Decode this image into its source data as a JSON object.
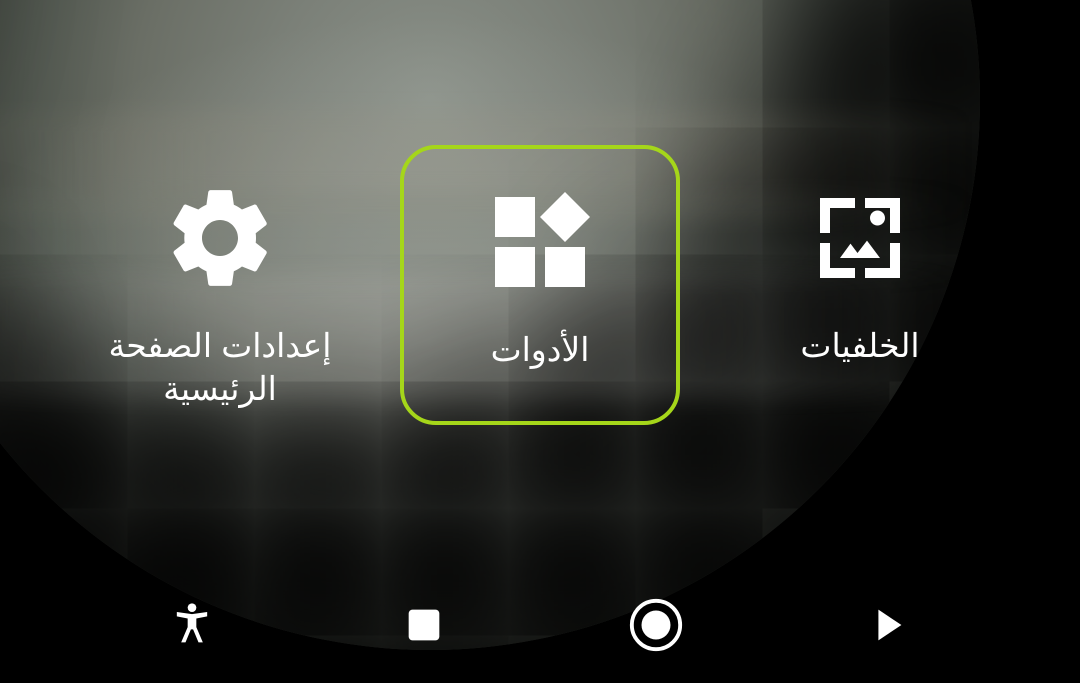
{
  "options": {
    "settings": {
      "label": "إعدادات الصفحة الرئيسية"
    },
    "widgets": {
      "label": "الأدوات",
      "focused": true
    },
    "wallpapers": {
      "label": "الخلفيات"
    }
  },
  "nav": {
    "accessibility": "accessibility",
    "recent": "recent-apps",
    "home": "home",
    "back": "back"
  },
  "colors": {
    "focus_border": "#a5d61a",
    "icon": "#ffffff"
  }
}
